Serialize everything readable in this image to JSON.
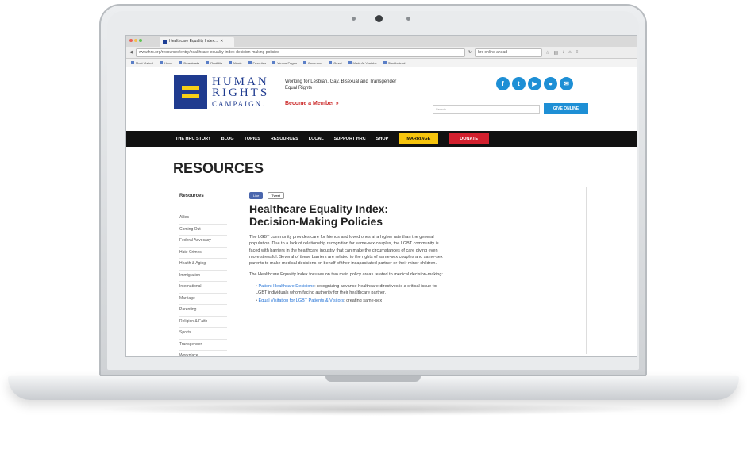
{
  "browser": {
    "tab_title": "Healthcare Equality Index...",
    "url": "www.hrc.org/resources/entry/healthcare-equality-index-decision-making-policies",
    "search_placeholder": "hrc online ahead",
    "bookmarks": [
      "Most Visited",
      "Home",
      "Downloads",
      "RealBits",
      "Music",
      "Favorites",
      "Vienna Pages",
      "Commons",
      "Gmail",
      "Made At Youtube",
      "Shot Lateral"
    ]
  },
  "site": {
    "logo": {
      "line1": "HUMAN",
      "line2": "RIGHTS",
      "line3": "CAMPAIGN."
    },
    "tagline": "Working for Lesbian, Gay, Bisexual and Transgender Equal Rights",
    "member_cta": "Become a Member »",
    "search_placeholder": "Search",
    "donate_top": "GIVE ONLINE",
    "social_icons": [
      "facebook-icon",
      "twitter-icon",
      "youtube-icon",
      "flickr-icon",
      "email-icon"
    ],
    "nav": [
      "THE HRC STORY",
      "BLOG",
      "TOPICS",
      "RESOURCES",
      "LOCAL",
      "SUPPORT HRC",
      "SHOP"
    ],
    "nav_marriage": "MARRIAGE",
    "nav_donate": "DONATE"
  },
  "page": {
    "title": "RESOURCES",
    "sidebar_heading": "Resources",
    "sidebar_items": [
      "Allies",
      "Coming Out",
      "Federal Advocacy",
      "Hate Crimes",
      "Health & Aging",
      "Immigration",
      "International",
      "Marriage",
      "Parenting",
      "Religion & Faith",
      "Sports",
      "Transgender",
      "Workplace"
    ],
    "share_like": "Like",
    "share_tweet": "Tweet",
    "article_title_line1": "Healthcare Equality Index:",
    "article_title_line2": "Decision-Making Policies",
    "paragraph1": "The LGBT community provides care for friends and loved ones at a higher rate than the general population. Due to a lack of relationship recognition for same-sex couples, the LGBT community is faced with barriers in the healthcare industry that can make the circumstances of care giving even more stressful. Several of these barriers are related to the rights of same-sex couples and same-sex parents to make medical decisions on behalf of their incapacitated partner or their minor children.",
    "paragraph2": "The Healthcare Equality Index focuses on two main policy areas related to medical decision-making:",
    "bullet1_link": "Patient Healthcare Decisions",
    "bullet1_text": ": recognizing advance healthcare directives is a critical issue for LGBT individuals whom facing authority for their healthcare partner.",
    "bullet2_link": "Equal Visitation for LGBT Patients & Visitors",
    "bullet2_text": ": creating same-sex"
  }
}
